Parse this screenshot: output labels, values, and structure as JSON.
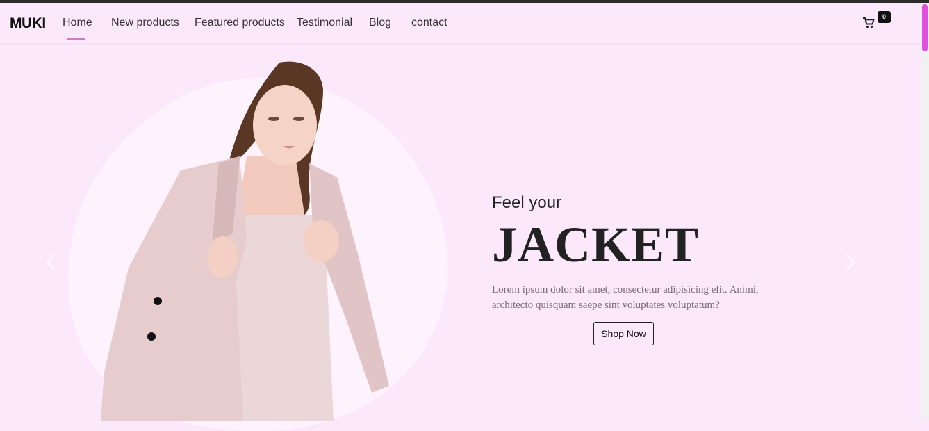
{
  "brand": "MUKI",
  "nav": {
    "items": [
      {
        "label": "Home",
        "active": true
      },
      {
        "label": "New products"
      },
      {
        "label": "Featured products"
      },
      {
        "label": "Testimonial"
      },
      {
        "label": "Blog"
      },
      {
        "label": "contact"
      }
    ]
  },
  "cart": {
    "count": "0",
    "icon": "cart-icon"
  },
  "hero": {
    "subtitle": "Feel your",
    "title": "JACKET",
    "description": "Lorem ipsum dolor sit amet, consectetur adipisicing elit. Animi, architecto quisquam saepe sint voluptates voluptatum?",
    "cta": "Shop Now",
    "image": "model-in-pink-jacket"
  },
  "colors": {
    "background": "#fce8fb",
    "accent": "#d178cf",
    "scroll_thumb": "#e04fe0"
  }
}
